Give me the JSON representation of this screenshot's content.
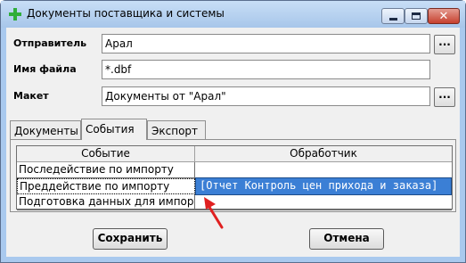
{
  "window": {
    "title": "Документы поставщика и системы",
    "title_icon": "green-cross-icon"
  },
  "form": {
    "sender": {
      "label": "Отправитель",
      "value": "Арал",
      "browse_label": "..."
    },
    "file_name": {
      "label": "Имя файла",
      "value": "*.dbf"
    },
    "layout": {
      "label": "Макет",
      "value": "Документы от \"Арал\"",
      "browse_label": "..."
    }
  },
  "tabs": [
    {
      "label": "Документы"
    },
    {
      "label": "События",
      "active": true
    },
    {
      "label": "Экспорт"
    }
  ],
  "events_table": {
    "columns": [
      "Событие",
      "Обработчик"
    ],
    "rows": [
      {
        "event": "Последействие по импорту",
        "handler": ""
      },
      {
        "event": "Преддействие по импорту",
        "handler": "[Отчет Контроль цен прихода и заказа]"
      },
      {
        "event": "Подготовка данных для импорта",
        "handler": ""
      }
    ]
  },
  "buttons": {
    "save": "Сохранить",
    "cancel": "Отмена"
  },
  "colors": {
    "title_bar": "#a9c9ee",
    "selection": "#3b7fd5",
    "annotation_arrow": "#e02020"
  }
}
